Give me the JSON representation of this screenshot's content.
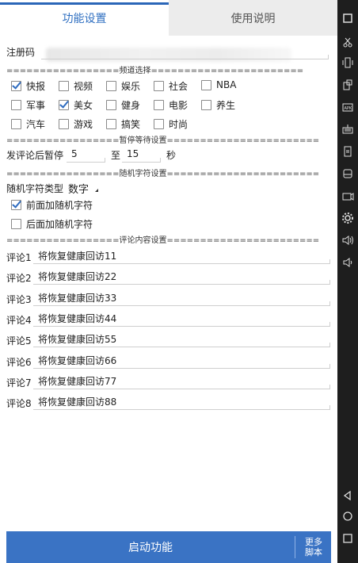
{
  "tabs": {
    "active": "功能设置",
    "inactive": "使用说明"
  },
  "register": {
    "label": "注册码"
  },
  "sections": {
    "channel": "=================频道选择=======================",
    "pause": "=================暂停等待设置=======================",
    "random": "=================随机字符设置=======================",
    "comment": "=================评论内容设置======================="
  },
  "channels": [
    {
      "label": "快报",
      "checked": true
    },
    {
      "label": "视频",
      "checked": false
    },
    {
      "label": "娱乐",
      "checked": false
    },
    {
      "label": "社会",
      "checked": false
    },
    {
      "label": "NBA",
      "checked": false
    },
    {
      "label": "军事",
      "checked": false
    },
    {
      "label": "美女",
      "checked": true
    },
    {
      "label": "健身",
      "checked": false
    },
    {
      "label": "电影",
      "checked": false
    },
    {
      "label": "养生",
      "checked": false
    },
    {
      "label": "汽车",
      "checked": false
    },
    {
      "label": "游戏",
      "checked": false
    },
    {
      "label": "搞笑",
      "checked": false
    },
    {
      "label": "时尚",
      "checked": false
    }
  ],
  "pause": {
    "label": "发评论后暂停",
    "from": "5",
    "to_label": "至",
    "to": "15",
    "unit": "秒"
  },
  "random": {
    "type_label": "随机字符类型",
    "type_value": "数字",
    "prefix": {
      "label": "前面加随机字符",
      "checked": true
    },
    "suffix": {
      "label": "后面加随机字符",
      "checked": false
    }
  },
  "comments": [
    {
      "label": "评论1",
      "value": "将恢复健康回访11"
    },
    {
      "label": "评论2",
      "value": "将恢复健康回访22"
    },
    {
      "label": "评论3",
      "value": "将恢复健康回访33"
    },
    {
      "label": "评论4",
      "value": "将恢复健康回访44"
    },
    {
      "label": "评论5",
      "value": "将恢复健康回访55"
    },
    {
      "label": "评论6",
      "value": "将恢复健康回访66"
    },
    {
      "label": "评论7",
      "value": "将恢复健康回访77"
    },
    {
      "label": "评论8",
      "value": "将恢复健康回访88"
    }
  ],
  "bottom": {
    "start": "启动功能",
    "more_line1": "更多",
    "more_line2": "脚本"
  },
  "colors": {
    "accent": "#3a73c4",
    "tab_text": "#2f6fc1",
    "check": "#2e6bbf"
  },
  "rail_icons": [
    "window-icon",
    "scissors-icon",
    "vibrate-icon",
    "rotate-icon",
    "apk-icon",
    "keyboard-icon",
    "screen-icon",
    "disk-icon",
    "camera-icon",
    "gear-icon",
    "volume-up-icon",
    "volume-down-icon",
    "back-icon",
    "home-icon",
    "recent-icon"
  ]
}
